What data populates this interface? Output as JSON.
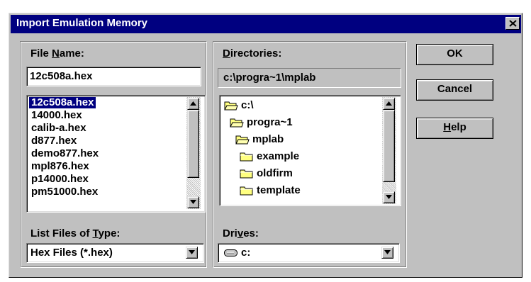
{
  "dialog": {
    "title": "Import Emulation Memory",
    "close_glyph": "✕"
  },
  "file_name": {
    "label_pre": "File ",
    "label_accel": "N",
    "label_post": "ame:",
    "value": "12c508a.hex",
    "files": [
      "12c508a.hex",
      "14000.hex",
      "calib-a.hex",
      "d877.hex",
      "demo877.hex",
      "mpl876.hex",
      "p14000.hex",
      "pm51000.hex"
    ],
    "selected_index": 0
  },
  "file_type": {
    "label_pre": "List Files of ",
    "label_accel": "T",
    "label_post": "ype:",
    "value": "Hex Files (*.hex)"
  },
  "directories": {
    "label_pre": "",
    "label_accel": "D",
    "label_post": "irectories:",
    "current_path": "c:\\progra~1\\mplab",
    "tree": [
      {
        "label": "c:\\",
        "icon": "open-folder-icon"
      },
      {
        "label": "progra~1",
        "icon": "open-folder-icon"
      },
      {
        "label": "mplab",
        "icon": "open-folder-icon"
      },
      {
        "label": "example",
        "icon": "folder-icon"
      },
      {
        "label": "oldfirm",
        "icon": "folder-icon"
      },
      {
        "label": "template",
        "icon": "folder-icon"
      }
    ]
  },
  "drives": {
    "label_pre": "Dri",
    "label_accel": "v",
    "label_post": "es:",
    "value": "c:",
    "icon": "hard-drive-icon"
  },
  "buttons": {
    "ok": "OK",
    "cancel": "Cancel",
    "help_accel": "H",
    "help_post": "elp"
  },
  "colors": {
    "titlebar": "#000080",
    "face": "#c0c0c0",
    "selection": "#000080",
    "folder": "#ffff80"
  }
}
